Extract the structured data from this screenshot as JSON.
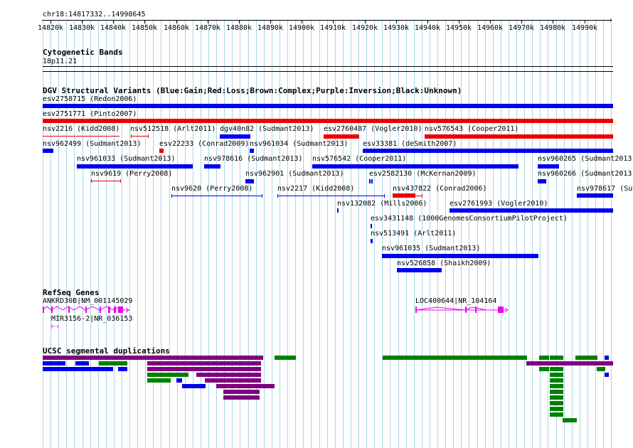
{
  "header": {
    "position": "chr18:14817332..14998645",
    "scale_ticks": [
      "14820k",
      "14830k",
      "14840k",
      "14850k",
      "14860k",
      "14870k",
      "14880k",
      "14890k",
      "14900k",
      "14910k",
      "14920k",
      "14930k",
      "14940k",
      "14950k",
      "14960k",
      "14970k",
      "14980k",
      "14990k"
    ]
  },
  "tracks": {
    "cyto": {
      "title": "Cytogenetic Bands",
      "band": "18p11.21"
    },
    "dgv": {
      "title": "DGV Structural Variants (Blue:Gain;Red:Loss;Brown:Complex;Purple:Inversion;Black:Unknown)",
      "labels": {
        "esv2758715": "esv2758715 (Redon2006)",
        "esv2751771": "esv2751771 (Pinto2007)",
        "nsv2216": "nsv2216 (Kidd2008)",
        "nsv512518": "nsv512518 (Arlt2011)",
        "dgv40n82": "dgv40n82 (Sudmant2013)",
        "esv2760487": "esv2760487 (Vogler2010)",
        "nsv576543": "nsv576543 (Cooper2011)",
        "nsv962499": "nsv962499 (Sudmant2013)",
        "esv22233": "esv22233 (Conrad2009)",
        "nsv961034": "nsv961034 (Sudmant2013)",
        "esv33381": "esv33381 (deSmith2007)",
        "nsv961033": "nsv961033 (Sudmant2013)",
        "nsv978616": "nsv978616 (Sudmant2013)",
        "nsv576542": "nsv576542 (Cooper2011)",
        "nsv960265": "nsv960265 (Sudmant2013)",
        "nsv9619": "nsv9619 (Perry2008)",
        "nsv962901": "nsv962901 (Sudmant2013)",
        "esv2582130": "esv2582130 (McKernan2009)",
        "nsv960266": "nsv960266 (Sudmant2013)",
        "nsv9620": "nsv9620 (Perry2008)",
        "nsv2217": "nsv2217 (Kidd2008)",
        "nsv437822": "nsv437822 (Conrad2006)",
        "nsv978617": "nsv978617 (Su",
        "nsv132082": "nsv132082 (Mills2006)",
        "esv2761993": "esv2761993 (Vogler2010)",
        "esv3431148": "esv3431148 (1000GenomesConsortiumPilotProject)",
        "nsv513491": "nsv513491 (Arlt2011)",
        "nsv961035": "nsv961035 (Sudmant2013)",
        "nsv526858": "nsv526858 (Shaikh2009)"
      }
    },
    "refseq": {
      "title": "RefSeq Genes",
      "genes": [
        "ANKRD30B|NM_001145029",
        "MIR3156-2|NR_036153",
        "LOC400644|NR_104164"
      ]
    },
    "segdup": {
      "title": "UCSC segmental duplications"
    }
  },
  "colors": {
    "gain": "#0000ee",
    "loss": "#ee0000",
    "inversion": "#800080",
    "segdup_green": "#008000",
    "segdup_purple": "#800080",
    "segdup_blue": "#0000ee",
    "gene": "#ee00ee",
    "grid": "#a9d6e6"
  }
}
